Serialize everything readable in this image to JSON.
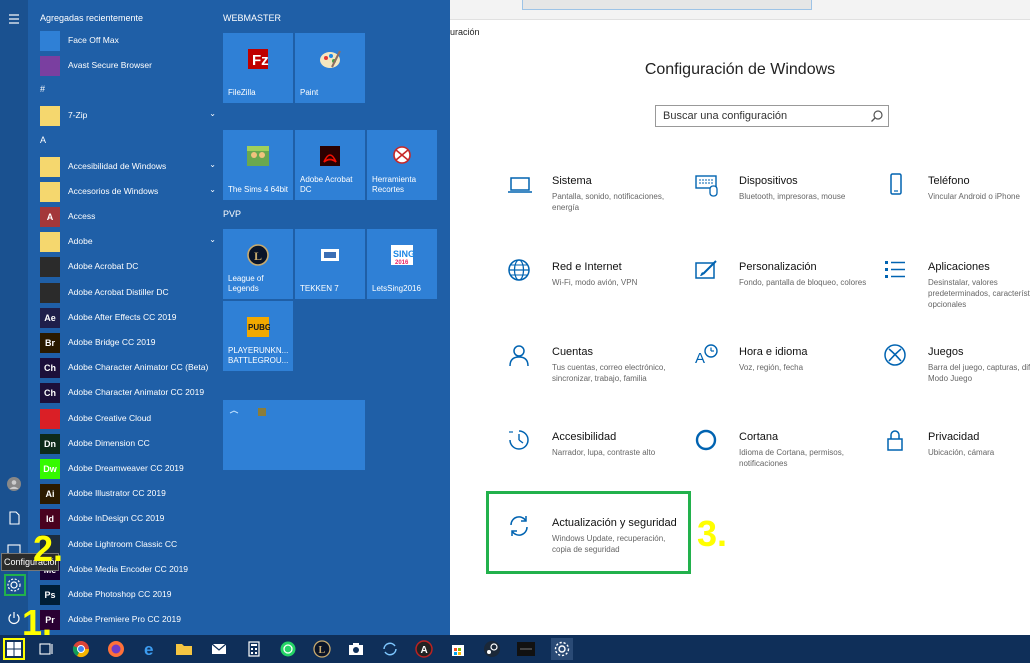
{
  "settings": {
    "breadcrumb": "uración",
    "title": "Configuración de Windows",
    "search_placeholder": "Buscar una configuración",
    "categories": [
      {
        "title": "Sistema",
        "desc": "Pantalla, sonido, notificaciones, energía",
        "icon": "laptop-icon"
      },
      {
        "title": "Dispositivos",
        "desc": "Bluetooth, impresoras, mouse",
        "icon": "keyboard-icon"
      },
      {
        "title": "Teléfono",
        "desc": "Vincular Android o iPhone",
        "icon": "phone-icon"
      },
      {
        "title": "Red e Internet",
        "desc": "Wi-Fi, modo avión, VPN",
        "icon": "globe-icon"
      },
      {
        "title": "Personalización",
        "desc": "Fondo, pantalla de bloqueo, colores",
        "icon": "paint-icon"
      },
      {
        "title": "Aplicaciones",
        "desc": "Desinstalar, valores predeterminados, características opcionales",
        "icon": "apps-list-icon"
      },
      {
        "title": "Cuentas",
        "desc": "Tus cuentas, correo electrónico, sincronizar, trabajo, familia",
        "icon": "person-icon"
      },
      {
        "title": "Hora e idioma",
        "desc": "Voz, región, fecha",
        "icon": "time-language-icon"
      },
      {
        "title": "Juegos",
        "desc": "Barra del juego, capturas, difusión, Modo Juego",
        "icon": "xbox-icon"
      },
      {
        "title": "Accesibilidad",
        "desc": "Narrador, lupa, contraste alto",
        "icon": "accessibility-icon"
      },
      {
        "title": "Cortana",
        "desc": "Idioma de Cortana, permisos, notificaciones",
        "icon": "cortana-icon"
      },
      {
        "title": "Privacidad",
        "desc": "Ubicación, cámara",
        "icon": "lock-icon"
      },
      {
        "title": "Actualización y seguridad",
        "desc": "Windows Update, recuperación, copia de seguridad",
        "icon": "update-icon"
      }
    ]
  },
  "annotations": {
    "n1": "1.",
    "n2": "2.",
    "n3": "3."
  },
  "start": {
    "recent_header": "Agregadas recientemente",
    "tooltip": "Configuración",
    "apps": [
      {
        "label": "Face Off Max",
        "tag": "",
        "color": "#2f80d6",
        "chev": ""
      },
      {
        "label": "Avast Secure Browser",
        "tag": "",
        "color": "#7a3fa0",
        "chev": ""
      },
      {
        "label": "#",
        "tag": "header"
      },
      {
        "label": "7-Zip",
        "tag": "",
        "color": "#f5d76e",
        "chev": "⌄"
      },
      {
        "label": "A",
        "tag": "header"
      },
      {
        "label": "Accesibilidad de Windows",
        "tag": "",
        "color": "#f5d76e",
        "chev": "⌄"
      },
      {
        "label": "Accesorios de Windows",
        "tag": "",
        "color": "#f5d76e",
        "chev": "⌄"
      },
      {
        "label": "Access",
        "tag": "A",
        "color": "#a4373a",
        "chev": ""
      },
      {
        "label": "Adobe",
        "tag": "",
        "color": "#f5d76e",
        "chev": "⌄"
      },
      {
        "label": "Adobe Acrobat DC",
        "tag": "",
        "color": "#2b2b2b",
        "chev": ""
      },
      {
        "label": "Adobe Acrobat Distiller DC",
        "tag": "",
        "color": "#2b2b2b",
        "chev": ""
      },
      {
        "label": "Adobe After Effects CC 2019",
        "tag": "Ae",
        "color": "#1f1f4a",
        "chev": ""
      },
      {
        "label": "Adobe Bridge CC 2019",
        "tag": "Br",
        "color": "#2a1a00",
        "chev": ""
      },
      {
        "label": "Adobe Character Animator CC (Beta)",
        "tag": "Ch",
        "color": "#1c0f3a",
        "chev": ""
      },
      {
        "label": "Adobe Character Animator CC 2019",
        "tag": "Ch",
        "color": "#1c0f3a",
        "chev": ""
      },
      {
        "label": "Adobe Creative Cloud",
        "tag": "",
        "color": "#da1f26",
        "chev": ""
      },
      {
        "label": "Adobe Dimension CC",
        "tag": "Dn",
        "color": "#0e2a1a",
        "chev": ""
      },
      {
        "label": "Adobe Dreamweaver CC 2019",
        "tag": "Dw",
        "color": "#35fa00",
        "chev": ""
      },
      {
        "label": "Adobe Illustrator CC 2019",
        "tag": "Ai",
        "color": "#2b1a00",
        "chev": ""
      },
      {
        "label": "Adobe InDesign CC 2019",
        "tag": "Id",
        "color": "#49021f",
        "chev": ""
      },
      {
        "label": "Adobe Lightroom Classic CC",
        "tag": "",
        "color": "#1d2d3f",
        "chev": ""
      },
      {
        "label": "Adobe Media Encoder CC 2019",
        "tag": "Me",
        "color": "#1a0033",
        "chev": ""
      },
      {
        "label": "Adobe Photoshop CC 2019",
        "tag": "Ps",
        "color": "#001e36",
        "chev": ""
      },
      {
        "label": "Adobe Premiere Pro CC 2019",
        "tag": "Pr",
        "color": "#2a0033",
        "chev": ""
      }
    ],
    "groups": {
      "webmaster": "WEBMASTER",
      "pvp": "PVP"
    },
    "tiles": [
      {
        "label": "FileZilla",
        "icon": "filezilla-icon"
      },
      {
        "label": "Paint",
        "icon": "paint-palette-icon"
      },
      {
        "label": "The Sims 4 64bit",
        "icon": "sims-icon"
      },
      {
        "label": "Adobe Acrobat DC",
        "icon": "acrobat-icon"
      },
      {
        "label": "Herramienta Recortes",
        "icon": "snipping-icon"
      },
      {
        "label": "League of Legends",
        "icon": "lol-icon"
      },
      {
        "label": "TEKKEN 7",
        "icon": "tekken-icon"
      },
      {
        "label": "LetsSing2016",
        "icon": "letssing-icon"
      },
      {
        "label": "PLAYERUNKN... BATTLEGROU...",
        "icon": "pubg-icon"
      },
      {
        "label": "",
        "icon": "folder-tile-icon"
      }
    ]
  },
  "colors": {
    "highlight_green": "#22b14c",
    "annotation_yellow": "#ffff00",
    "accent_blue": "#0063b1"
  }
}
